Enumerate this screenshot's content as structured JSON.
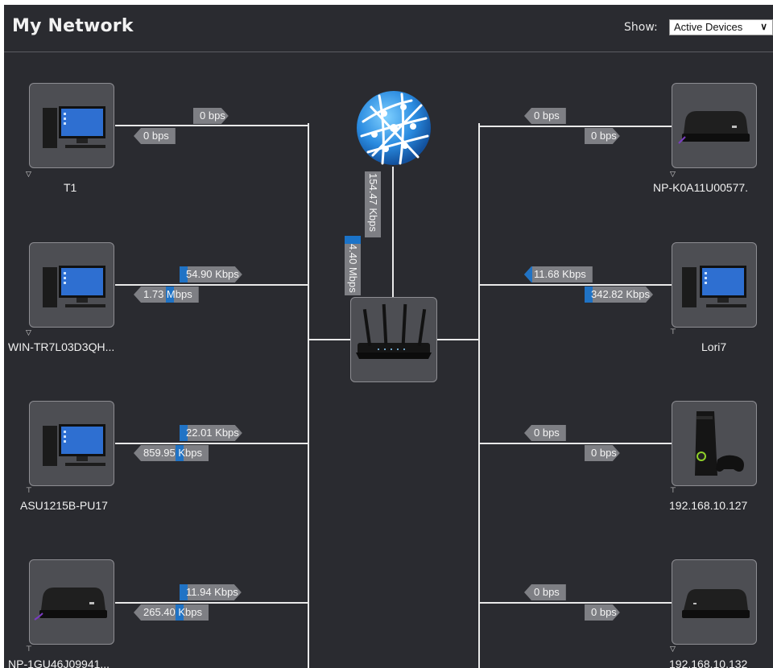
{
  "header": {
    "title": "My Network",
    "show_label": "Show:",
    "show_value": "Active Devices"
  },
  "internet": {
    "icon": "globe-icon",
    "upload": "154.47 Kbps",
    "download": "4.40 Mbps"
  },
  "router": {
    "icon": "router-icon"
  },
  "left_devices": [
    {
      "name": "T1",
      "icon": "desktop-computer-icon",
      "conn": "ethernet",
      "up": "0 bps",
      "down": "0 bps"
    },
    {
      "name": "WIN-TR7L03D3QH...",
      "icon": "desktop-computer-icon",
      "conn": "ethernet",
      "up": "54.90 Kbps",
      "down": "1.73 Mbps"
    },
    {
      "name": "ASU1215B-PU17",
      "icon": "desktop-computer-icon",
      "conn": "wireless",
      "up": "22.01 Kbps",
      "down": "859.95 Kbps"
    },
    {
      "name": "NP-1GU46J09941...",
      "icon": "media-player-icon",
      "conn": "wireless",
      "up": "11.94 Kbps",
      "down": "265.40 Kbps"
    }
  ],
  "right_devices": [
    {
      "name": "NP-K0A11U00577.",
      "icon": "media-player-icon",
      "conn": "ethernet",
      "up": "0 bps",
      "down": "0 bps"
    },
    {
      "name": "Lori7",
      "icon": "desktop-computer-icon",
      "conn": "wireless",
      "up": "11.68 Kbps",
      "down": "342.82 Kbps"
    },
    {
      "name": "192.168.10.127",
      "icon": "game-console-icon",
      "conn": "wireless",
      "up": "0 bps",
      "down": "0 bps"
    },
    {
      "name": "192.168.10.132",
      "icon": "media-player-icon",
      "conn": "ethernet",
      "up": "0 bps",
      "down": "0 bps"
    }
  ],
  "colors": {
    "background": "#2a2b30",
    "tile": "#4d4e53",
    "tag": "#7e7f84",
    "accent": "#1b73c8",
    "line": "#e9e9e9"
  }
}
